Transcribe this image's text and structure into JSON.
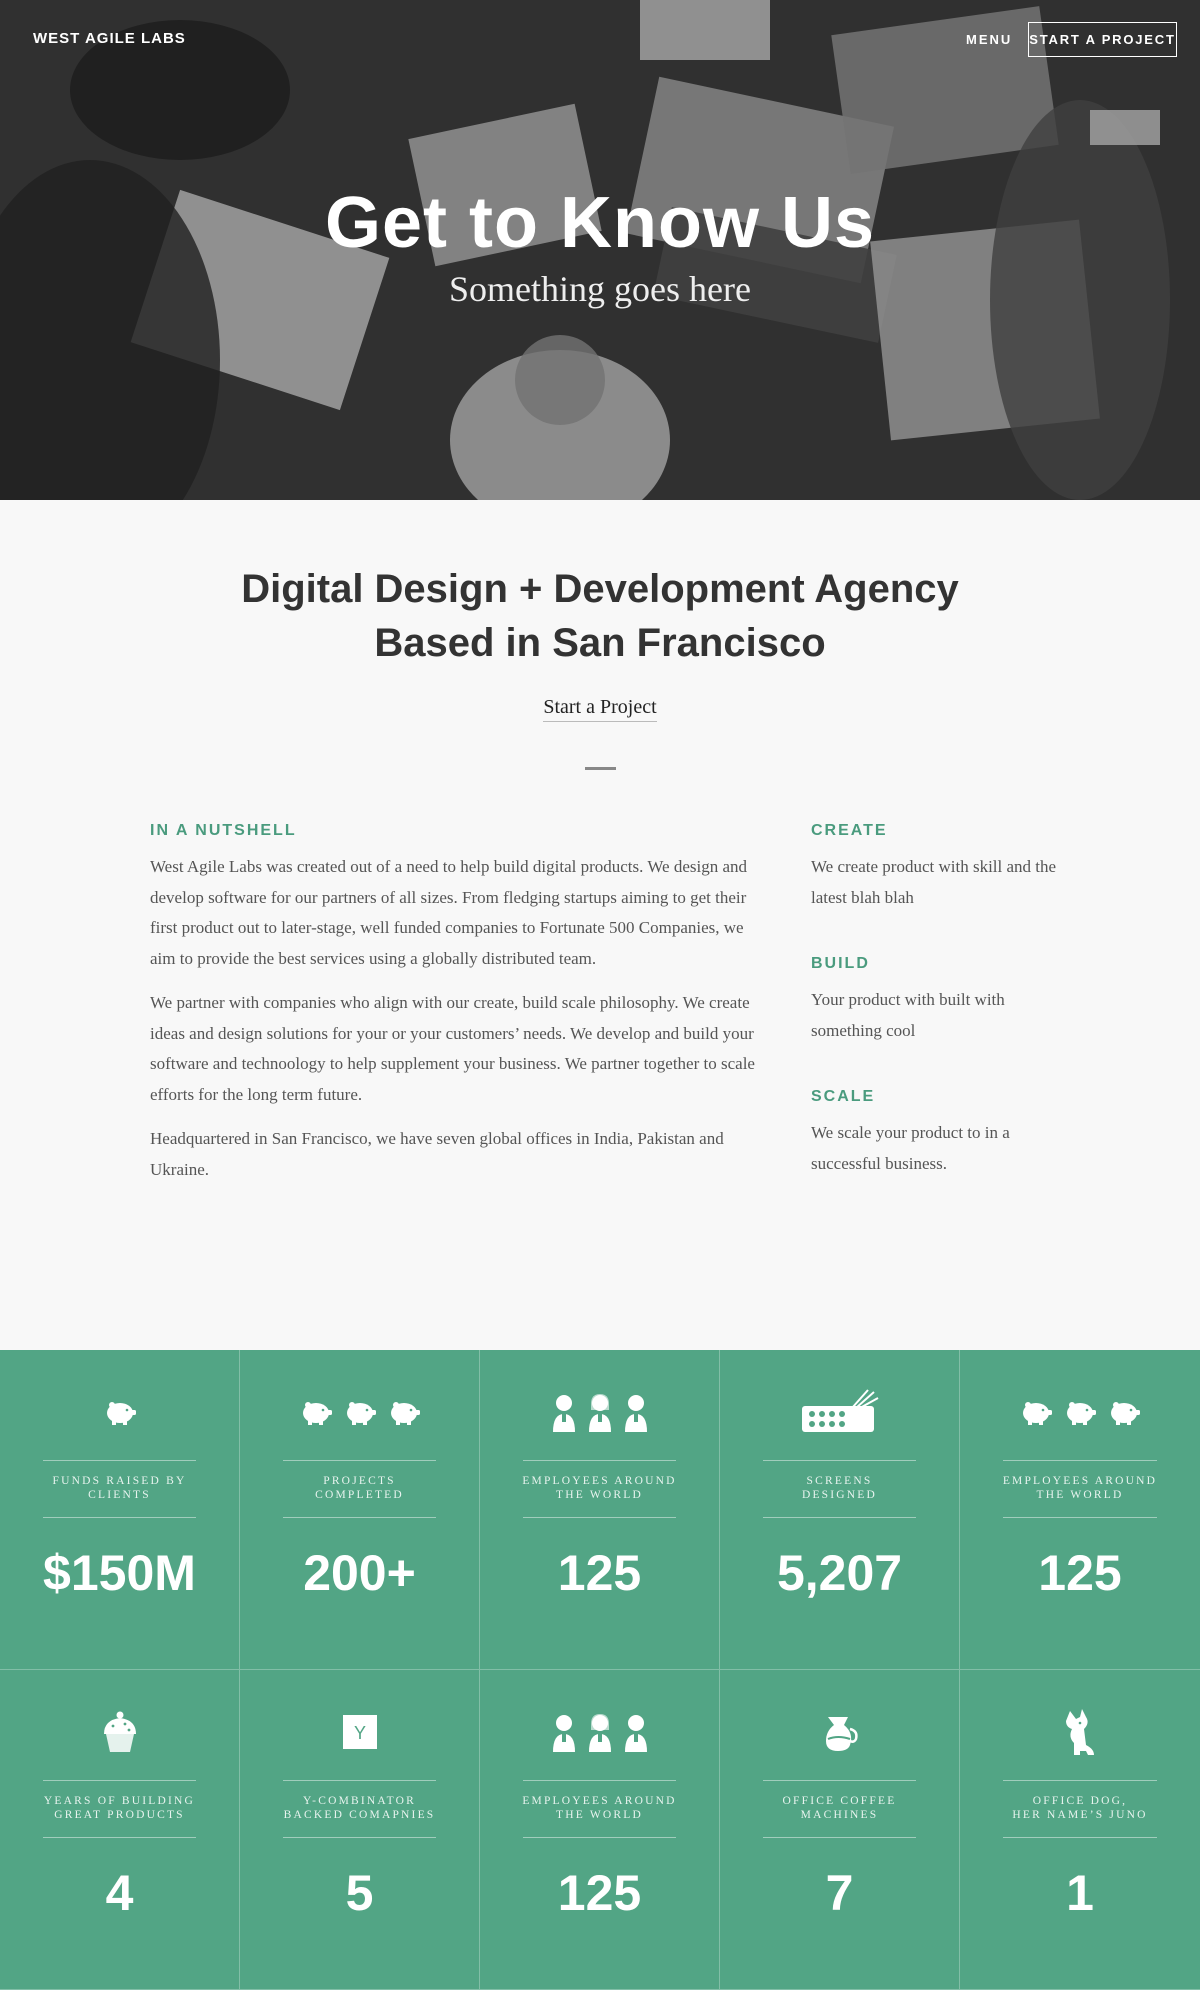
{
  "nav": {
    "logo": "WEST AGILE LABS",
    "menu": "MENU",
    "cta": "START A PROJECT"
  },
  "hero": {
    "title": "Get to Know Us",
    "subtitle": "Something goes here"
  },
  "intro": {
    "title_line1": "Digital Design + Development Agency",
    "title_line2": "Based in San Francisco",
    "link": "Start a Project"
  },
  "nutshell": {
    "heading": "IN A NUTSHELL",
    "paragraphs": [
      "West Agile Labs was created out of a need to help build digital products. We design and develop software for our partners of all sizes. From fledging startups aiming to get their first product out to later-stage, well funded companies to Fortunate 500 Companies, we aim to provide the best services using a globally distributed team.",
      "We partner with companies who align with our create, build scale philosophy. We create ideas and design solutions for your or your customers’ needs. We develop and build your software and technoology to help supplement your business. We partner together to scale efforts for the long term future.",
      "Headquartered in San Francisco, we have seven global offices in India, Pakistan and Ukraine."
    ]
  },
  "side": [
    {
      "heading": "CREATE",
      "text": "We create product with skill and the latest blah blah"
    },
    {
      "heading": "BUILD",
      "text": "Your product with built with something cool"
    },
    {
      "heading": "SCALE",
      "text": "We scale your product to in a successful business."
    }
  ],
  "stats": [
    {
      "icon": "piggy-bank-icon",
      "label": "Funds raised by\nclients",
      "value": "$150M"
    },
    {
      "icon": "piggy-banks-icon",
      "label": "Projects\ncompleted",
      "value": "200+"
    },
    {
      "icon": "people-icon",
      "label": "Employees around\nthe world",
      "value": "125"
    },
    {
      "icon": "paint-palette-icon",
      "label": "Screens\ndesigned",
      "value": "5,207"
    },
    {
      "icon": "piggy-banks-icon",
      "label": "Employees around\nthe world",
      "value": "125"
    },
    {
      "icon": "cupcake-icon",
      "label": "Years of building\ngreat products",
      "value": "4"
    },
    {
      "icon": "y-combinator-icon",
      "label": "Y-Combinator\nbacked comapnies",
      "value": "5"
    },
    {
      "icon": "people-icon",
      "label": "Employees around\nthe world",
      "value": "125"
    },
    {
      "icon": "coffee-pot-icon",
      "label": "Office coffee\nmachines",
      "value": "7"
    },
    {
      "icon": "dog-icon",
      "label": "Office dog,\nher name’s Juno",
      "value": "1"
    }
  ],
  "colors": {
    "accent": "#4a9b7e",
    "stats_bg": "#52a585"
  }
}
